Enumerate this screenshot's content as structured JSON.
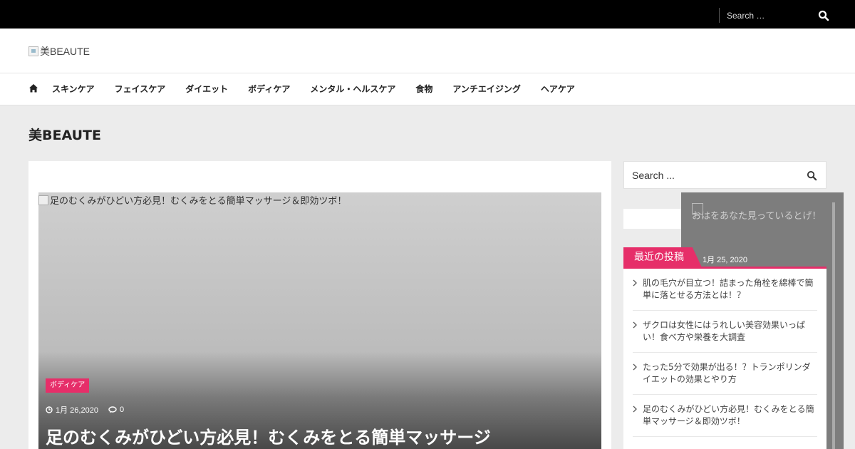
{
  "topbar": {
    "search_placeholder": "Search …"
  },
  "header": {
    "logo_alt": "美BEAUTE"
  },
  "nav": {
    "items": [
      "スキンケア",
      "フェイスケア",
      "ダイエット",
      "ボディケア",
      "メンタル・ヘルスケア",
      "食物",
      "アンチエイジング",
      "ヘアケア"
    ]
  },
  "page": {
    "title": "美BEAUTE"
  },
  "featured": {
    "image_alt": "足のむくみがひどい方必見！むくみをとる簡単マッサージ＆即効ツボ！",
    "category": "ボディケア",
    "date": "1月 26,2020",
    "comments": "0",
    "title": "足のむくみがひどい方必見！むくみをとる簡単マッサージ"
  },
  "sidebar": {
    "search_placeholder": "Search ...",
    "overlay_text": "おはをあなた見っているとげ！",
    "overlay_date": "1月 25, 2020",
    "recent_heading": "最近の投稿",
    "recent_posts": [
      "肌の毛穴が目立つ！詰まった角栓を綿棒で簡単に落とせる方法とは！？",
      "ザクロは女性にはうれしい美容効果いっぱい！食べ方や栄養を大調査",
      "たった5分で効果が出る！？トランポリンダイエットの効果とやり方",
      "足のむくみがひどい方必見！むくみをとる簡単マッサージ＆即効ツボ！"
    ]
  },
  "colors": {
    "accent": "#e62e69",
    "topbar": "#000000",
    "background": "#ececec"
  }
}
